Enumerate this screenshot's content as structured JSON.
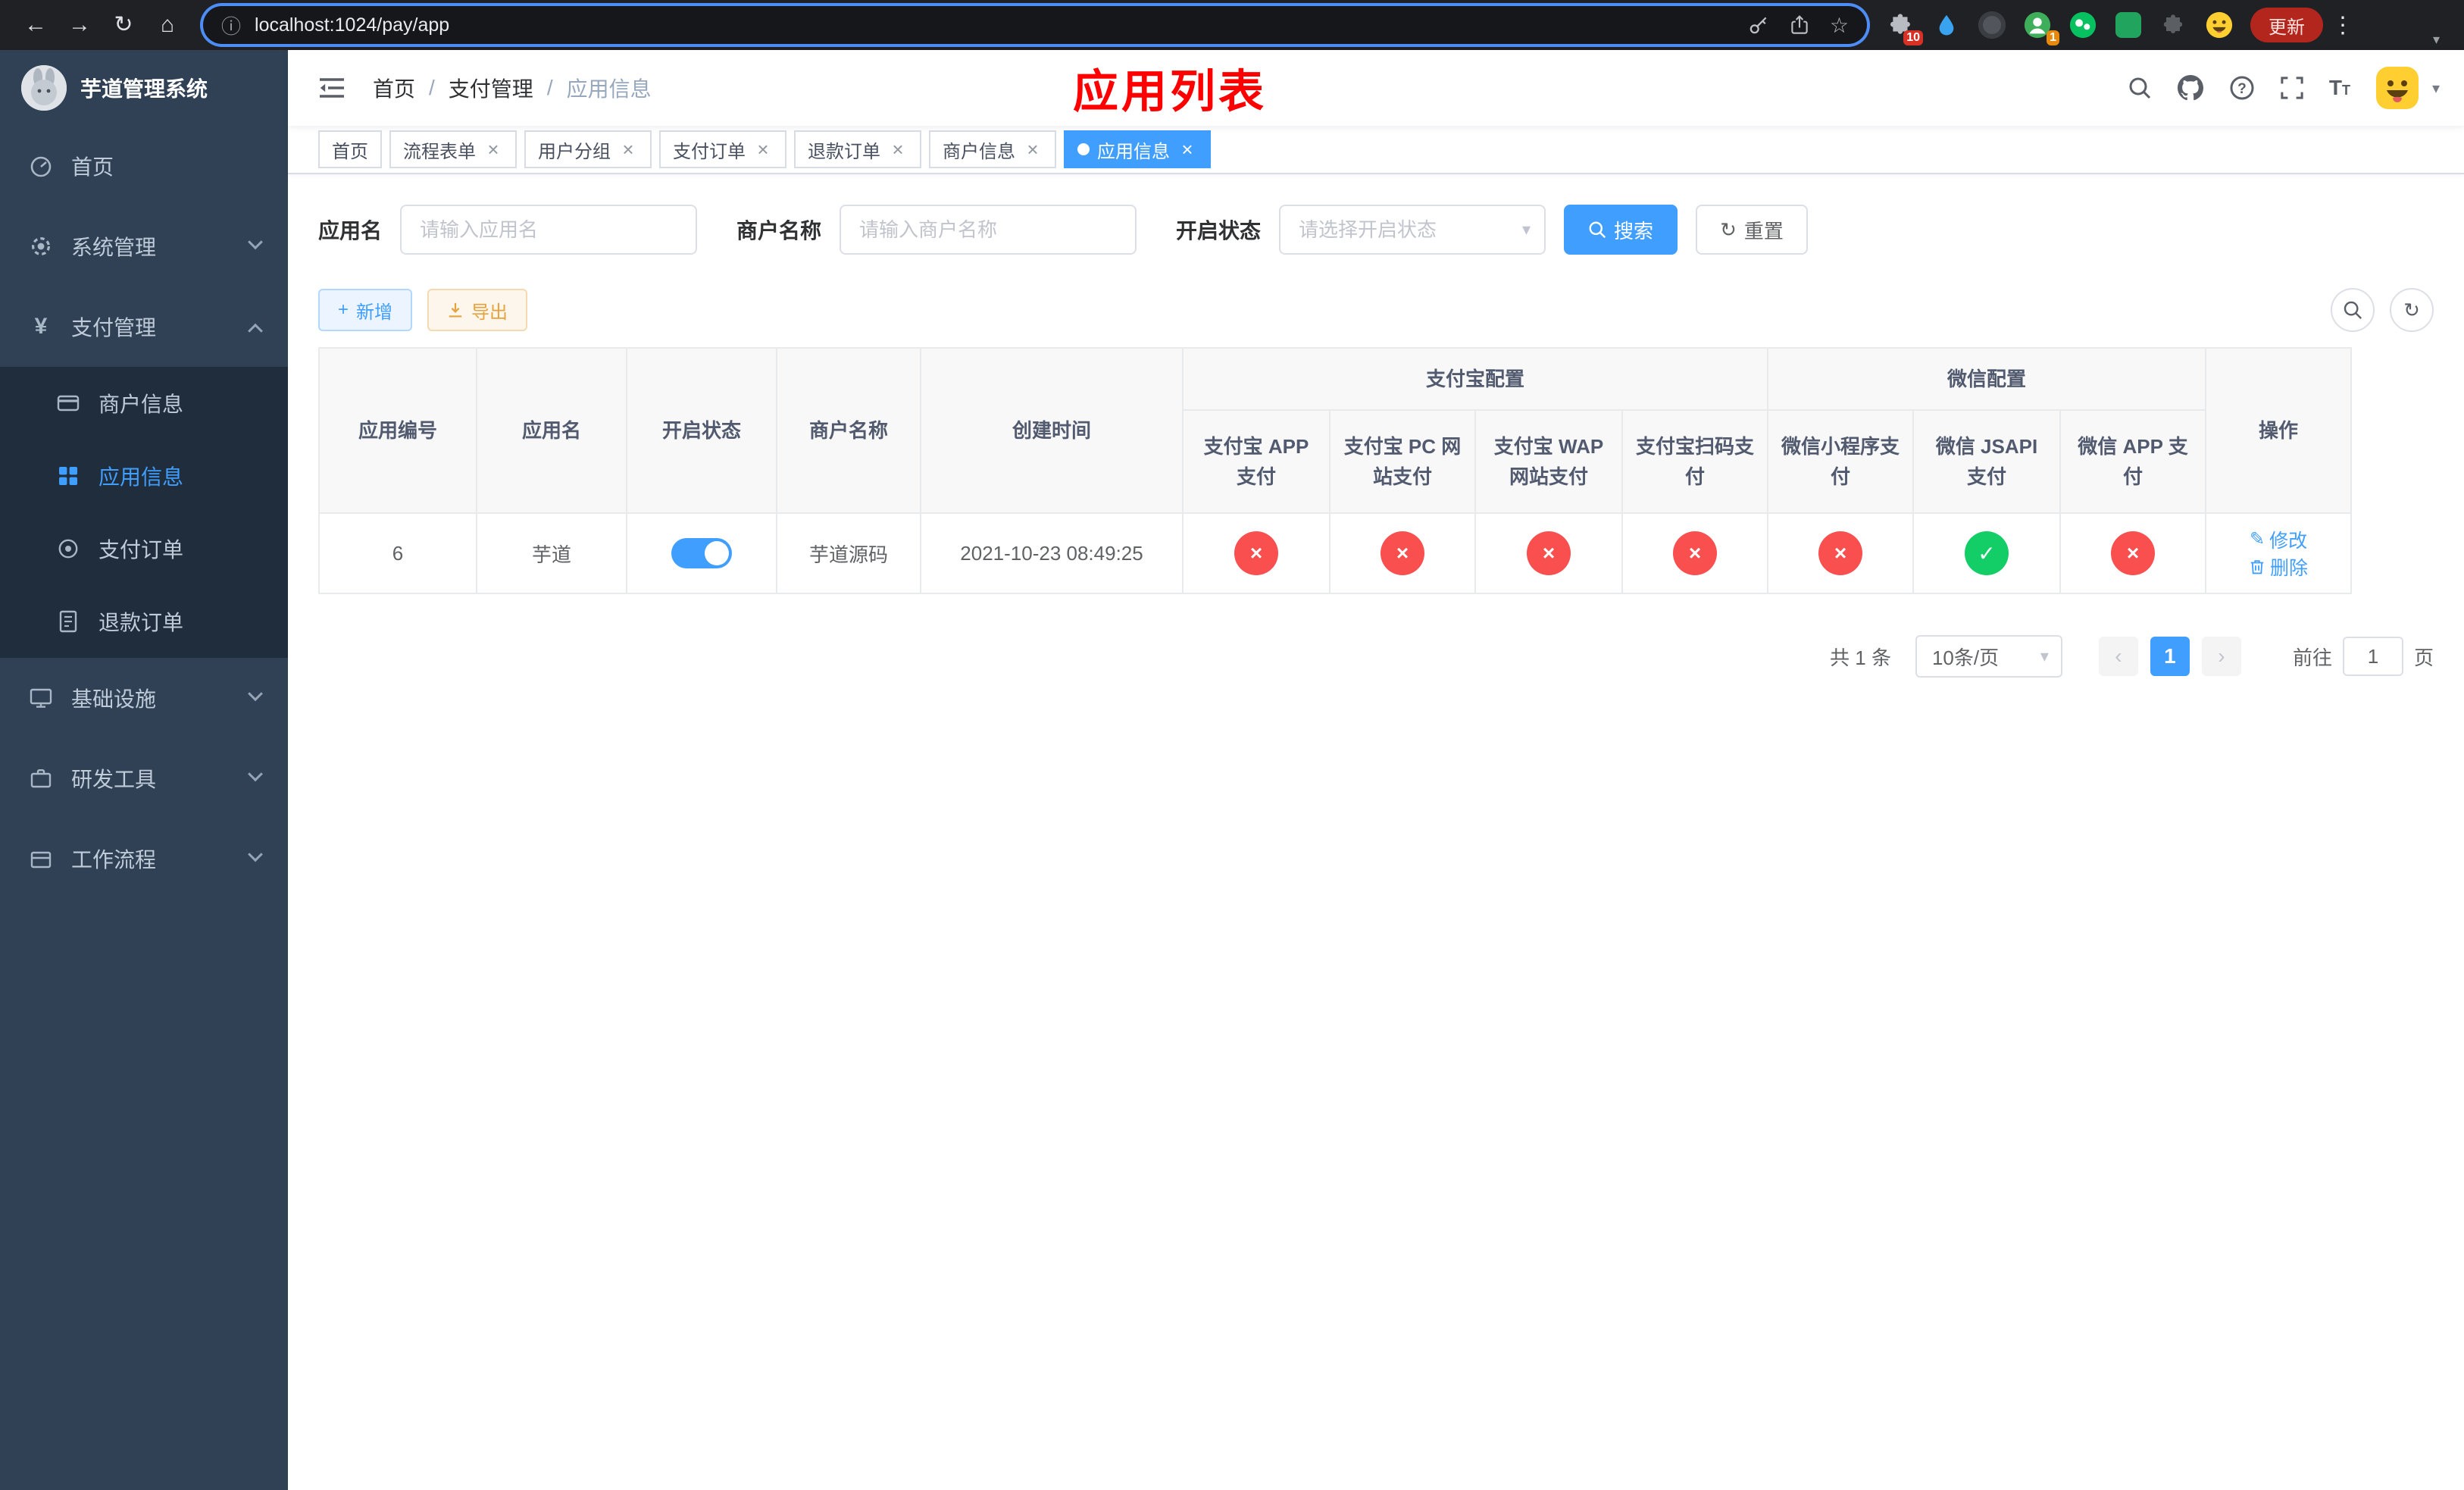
{
  "browser": {
    "url": "localhost:1024/pay/app",
    "update_button": "更新",
    "extensions_badge": "10",
    "profile_badge": "1"
  },
  "sidebar": {
    "title": "芋道管理系统",
    "items": [
      {
        "label": "首页"
      },
      {
        "label": "系统管理"
      },
      {
        "label": "支付管理"
      },
      {
        "label": "商户信息"
      },
      {
        "label": "应用信息"
      },
      {
        "label": "支付订单"
      },
      {
        "label": "退款订单"
      },
      {
        "label": "基础设施"
      },
      {
        "label": "研发工具"
      },
      {
        "label": "工作流程"
      }
    ]
  },
  "navbar": {
    "breadcrumb": [
      "首页",
      "支付管理",
      "应用信息"
    ],
    "annotation": "应用列表"
  },
  "tabs": [
    {
      "label": "首页",
      "closable": false,
      "active": false
    },
    {
      "label": "流程表单",
      "closable": true,
      "active": false
    },
    {
      "label": "用户分组",
      "closable": true,
      "active": false
    },
    {
      "label": "支付订单",
      "closable": true,
      "active": false
    },
    {
      "label": "退款订单",
      "closable": true,
      "active": false
    },
    {
      "label": "商户信息",
      "closable": true,
      "active": false
    },
    {
      "label": "应用信息",
      "closable": true,
      "active": true
    }
  ],
  "filters": {
    "app_name": {
      "label": "应用名",
      "placeholder": "请输入应用名",
      "value": ""
    },
    "merchant_name": {
      "label": "商户名称",
      "placeholder": "请输入商户名称",
      "value": ""
    },
    "status": {
      "label": "开启状态",
      "placeholder": "请选择开启状态",
      "value": ""
    },
    "search_button": "搜索",
    "reset_button": "重置"
  },
  "toolbar": {
    "add_button": "新增",
    "export_button": "导出"
  },
  "table": {
    "plain_columns": [
      "应用编号",
      "应用名",
      "开启状态",
      "商户名称",
      "创建时间"
    ],
    "groups": [
      {
        "label": "支付宝配置",
        "children": [
          "支付宝 APP 支付",
          "支付宝 PC 网站支付",
          "支付宝 WAP 网站支付",
          "支付宝扫码支付"
        ]
      },
      {
        "label": "微信配置",
        "children": [
          "微信小程序支付",
          "微信 JSAPI 支付",
          "微信 APP 支付"
        ]
      }
    ],
    "action_column": "操作",
    "rows": [
      {
        "app_id": "6",
        "app_name": "芋道",
        "enabled": true,
        "merchant_name": "芋道源码",
        "create_time": "2021-10-23 08:49:25",
        "pay_configs": [
          false,
          false,
          false,
          false,
          false,
          true,
          false
        ],
        "edit_label": "修改",
        "delete_label": "删除"
      }
    ]
  },
  "pagination": {
    "total_text": "共 1 条",
    "page_size_text": "10条/页",
    "current_page": "1",
    "goto_label": "前往",
    "goto_value": "1",
    "goto_unit": "页"
  },
  "icons": {
    "back": "←",
    "forward": "→",
    "reload": "↻",
    "home": "⌂",
    "info": "ⓘ",
    "star": "☆",
    "menu_dots": "⋮",
    "caret_down": "▾",
    "close": "×",
    "check": "✓",
    "plus": "+",
    "reset": "↻",
    "prev": "‹",
    "next": "›",
    "edit": "✎",
    "search_small": "⌕"
  },
  "colors": {
    "accent": "#409eff",
    "success": "#13ce66",
    "danger": "#fa4f4f",
    "warning": "#e6a23c",
    "sidebar": "#304156"
  }
}
